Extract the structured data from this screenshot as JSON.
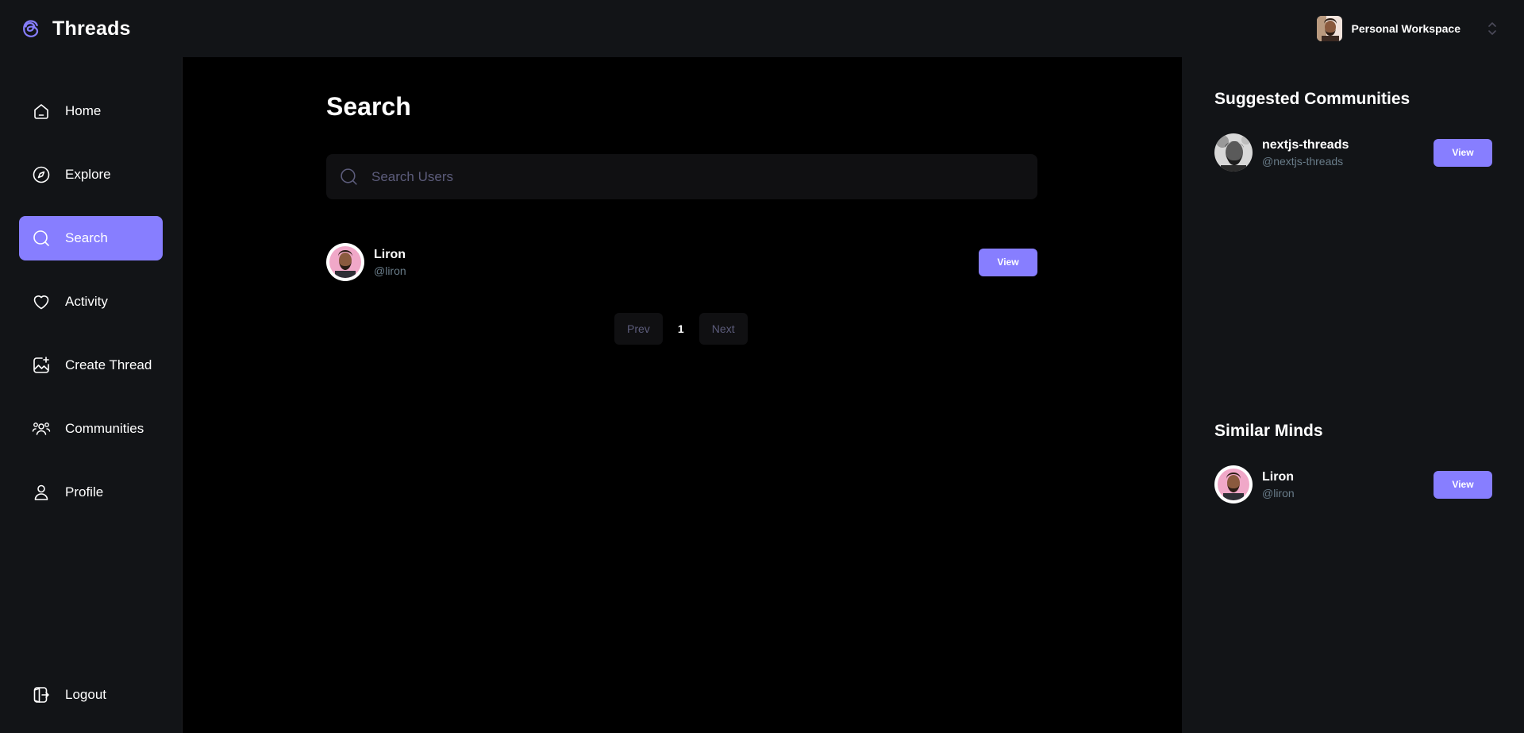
{
  "app": {
    "name": "Threads",
    "logo_icon": "threads-logo-icon"
  },
  "workspace": {
    "label": "Personal Workspace",
    "switch_icon": "chevron-updown-icon"
  },
  "colors": {
    "accent": "#877eff",
    "panel": "#121417",
    "background": "#000000",
    "muted": "#697c89",
    "input_bg": "#101012",
    "placeholder": "#5c5c7b"
  },
  "sidebar": {
    "items": [
      {
        "label": "Home",
        "icon": "home-icon",
        "active": false
      },
      {
        "label": "Explore",
        "icon": "compass-icon",
        "active": false
      },
      {
        "label": "Search",
        "icon": "search-icon",
        "active": true
      },
      {
        "label": "Activity",
        "icon": "heart-icon",
        "active": false
      },
      {
        "label": "Create Thread",
        "icon": "create-image-icon",
        "active": false
      },
      {
        "label": "Communities",
        "icon": "users-icon",
        "active": false
      },
      {
        "label": "Profile",
        "icon": "user-icon",
        "active": false
      }
    ],
    "logout": {
      "label": "Logout",
      "icon": "logout-icon"
    }
  },
  "main": {
    "title": "Search",
    "search": {
      "placeholder": "Search Users",
      "value": ""
    },
    "results": [
      {
        "name": "Liron",
        "handle": "@liron",
        "button": "View"
      }
    ],
    "pagination": {
      "prev": "Prev",
      "page": "1",
      "next": "Next"
    }
  },
  "rightbar": {
    "suggested": {
      "title": "Suggested Communities",
      "items": [
        {
          "name": "nextjs-threads",
          "handle": "@nextjs-threads",
          "button": "View"
        }
      ]
    },
    "similar": {
      "title": "Similar Minds",
      "items": [
        {
          "name": "Liron",
          "handle": "@liron",
          "button": "View"
        }
      ]
    }
  }
}
